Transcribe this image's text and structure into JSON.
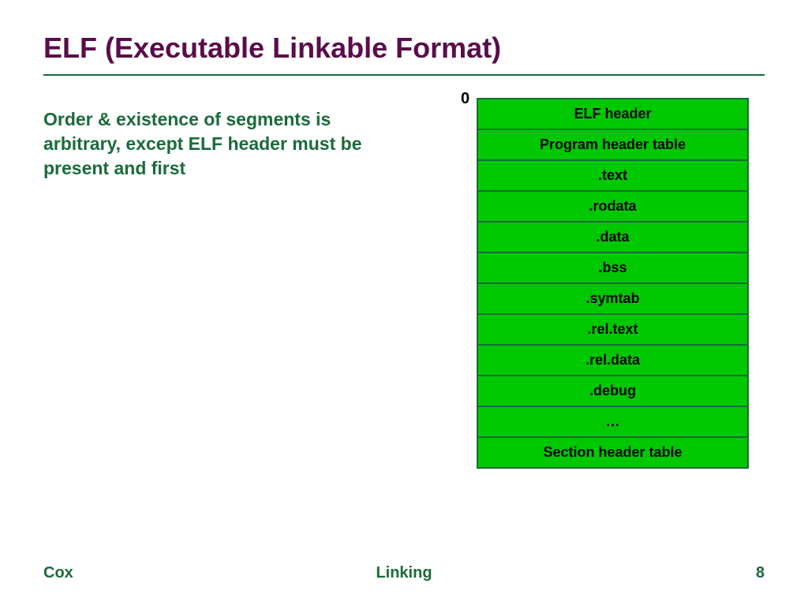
{
  "title": "ELF (Executable Linkable Format)",
  "body_text": "Order & existence of segments is arbitrary, except ELF header must be present and first",
  "zero_label": "0",
  "segments": [
    "ELF header",
    "Program header table",
    ".text",
    ".rodata",
    ".data",
    ".bss",
    ".symtab",
    ".rel.text",
    ".rel.data",
    ".debug",
    "…",
    "Section header table"
  ],
  "footer": {
    "left": "Cox",
    "center": "Linking",
    "right": "8"
  }
}
